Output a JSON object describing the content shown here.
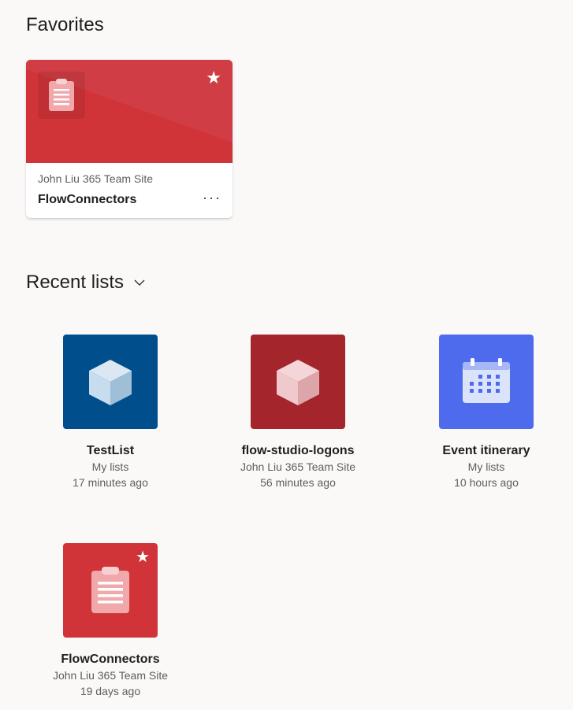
{
  "favorites": {
    "title": "Favorites",
    "card": {
      "site": "John Liu 365 Team Site",
      "name": "FlowConnectors",
      "more": "···",
      "star": "★",
      "icon": "clipboard-list-icon",
      "color": "#d13438"
    }
  },
  "recent": {
    "title": "Recent lists",
    "items": [
      {
        "name": "TestList",
        "location": "My lists",
        "time": "17 minutes ago",
        "icon": "cube-icon",
        "color": "#004e8c"
      },
      {
        "name": "flow-studio-logons",
        "location": "John Liu 365 Team Site",
        "time": "56 minutes ago",
        "icon": "cube-icon",
        "color": "#a4262c"
      },
      {
        "name": "Event itinerary",
        "location": "My lists",
        "time": "10 hours ago",
        "icon": "calendar-icon",
        "color": "#4f6bed"
      },
      {
        "name": "FlowConnectors",
        "location": "John Liu 365 Team Site",
        "time": "19 days ago",
        "icon": "clipboard-list-icon",
        "color": "#d13438",
        "star": "★"
      }
    ]
  }
}
